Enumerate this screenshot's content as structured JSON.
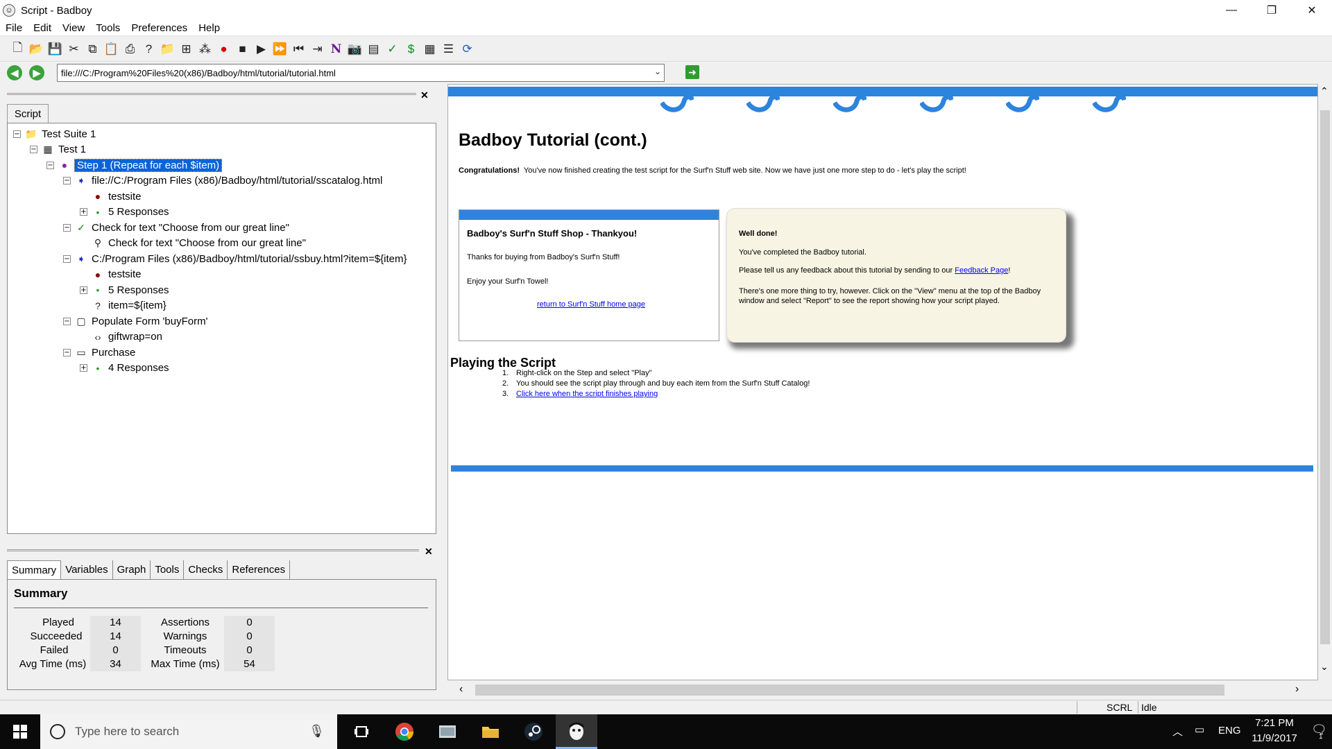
{
  "window": {
    "title": "Script - Badboy",
    "minimize": "—",
    "maximize": "❐",
    "close": "✕"
  },
  "menu": [
    "File",
    "Edit",
    "View",
    "Tools",
    "Preferences",
    "Help"
  ],
  "address": {
    "url": "file:///C:/Program%20Files%20(x86)/Badboy/html/tutorial/tutorial.html"
  },
  "left_panel": {
    "tab_label": "Script",
    "tree": [
      {
        "label": "Test Suite 1",
        "icon": "folder-icon"
      },
      {
        "label": "Test 1",
        "icon": "test-icon"
      },
      {
        "label": "Step 1 (Repeat for each $item)",
        "icon": "step-icon",
        "selected": true
      },
      {
        "label": "file://C:/Program Files (x86)/Badboy/html/tutorial/sscatalog.html",
        "icon": "request-icon"
      },
      {
        "label": "testsite",
        "icon": "host-icon"
      },
      {
        "label": "5 Responses",
        "icon": "responses-icon"
      },
      {
        "label": "Check for text \"Choose from our great line\"",
        "icon": "check-icon"
      },
      {
        "label": "Check for text \"Choose from our great line\"",
        "icon": "find-icon"
      },
      {
        "label": "C:/Program Files (x86)/Badboy/html/tutorial/ssbuy.html?item=${item}",
        "icon": "request-icon"
      },
      {
        "label": "testsite",
        "icon": "host-icon"
      },
      {
        "label": "5 Responses",
        "icon": "responses-icon"
      },
      {
        "label": "item=${item}",
        "icon": "param-icon"
      },
      {
        "label": "Populate Form 'buyForm'",
        "icon": "form-icon"
      },
      {
        "label": "giftwrap=on",
        "icon": "field-icon"
      },
      {
        "label": "Purchase",
        "icon": "click-icon"
      },
      {
        "label": "4 Responses",
        "icon": "responses-icon"
      }
    ],
    "summary_tabs": [
      "Summary",
      "Variables",
      "Graph",
      "Tools",
      "Checks",
      "References"
    ],
    "summary": {
      "title": "Summary",
      "left": [
        {
          "label": "Played",
          "value": "14"
        },
        {
          "label": "Succeeded",
          "value": "14"
        },
        {
          "label": "Failed",
          "value": "0"
        },
        {
          "label": "Avg Time (ms)",
          "value": "34"
        }
      ],
      "right": [
        {
          "label": "Assertions",
          "value": "0"
        },
        {
          "label": "Warnings",
          "value": "0"
        },
        {
          "label": "Timeouts",
          "value": "0"
        },
        {
          "label": "Max Time (ms)",
          "value": "54"
        }
      ]
    }
  },
  "page": {
    "heading": "Badboy Tutorial (cont.)",
    "congrats_bold": "Congratulations!",
    "congrats_text": "You've now finished creating the test script for the Surf'n Stuff web site. Now we have just one more step to do - let's play the script!",
    "shop_box": {
      "title": "Badboy's Surf'n Stuff Shop - Thankyou!",
      "p1": "Thanks for buying from Badboy's Surf'n Stuff!",
      "p2": "Enjoy your Surf'n Towel!",
      "link": "return to Surf'n Stuff home page"
    },
    "done_box": {
      "title": "Well done!",
      "p1": "You've completed the Badboy tutorial.",
      "p2_before": "Please tell us any feedback about this tutorial by sending to our",
      "p2_link": "Feedback Page",
      "p2_after": "!",
      "p3": "There's one more thing to try, however. Click on the \"View\" menu at the top of the Badboy window and select \"Report\" to see the report showing how your script played."
    },
    "playing_title": "Playing the Script",
    "steps": [
      {
        "num": "1.",
        "text": "Right-click on the Step and select \"Play\""
      },
      {
        "num": "2.",
        "text": "You should see the script play through and buy each item from the Surf'n Stuff Catalog!"
      },
      {
        "num": "3.",
        "text": "Click here when the script finishes playing"
      }
    ]
  },
  "statusbar": {
    "scrl": "SCRL",
    "state": "Idle"
  },
  "taskbar": {
    "search_placeholder": "Type here to search",
    "lang": "ENG",
    "time": "7:21 PM",
    "date": "11/9/2017",
    "notifications": "1"
  },
  "colors": {
    "accent_blue": "#2c84dd",
    "selection": "#0a64d8",
    "done_box_bg": "#f8f4e3"
  }
}
